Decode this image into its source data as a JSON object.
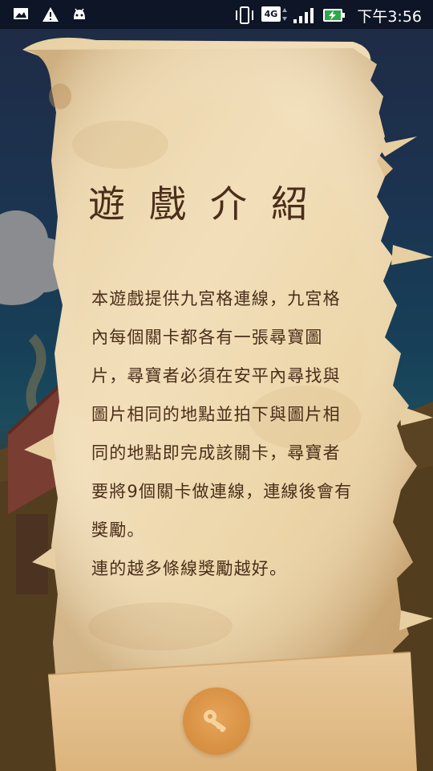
{
  "status_bar": {
    "time": "下午3:56",
    "network": "4G",
    "icons": [
      "image-icon",
      "warning-icon",
      "android-icon",
      "vibrate-icon",
      "network-4g-icon",
      "signal-icon",
      "battery-charging-icon"
    ]
  },
  "intro": {
    "title": "遊戲介紹",
    "paragraphs": [
      "本遊戲提供九宮格連線，九宮格內每個關卡都各有一張尋寶圖片，尋寶者必須在安平內尋找與圖片相同的地點並拍下與圖片相同的地點即完成該關卡，尋寶者要將9個關卡做連線，連線後會有獎勵。",
      "連的越多條線獎勵越好。"
    ]
  },
  "action": {
    "icon": "key-icon"
  },
  "colors": {
    "parchment": "#efd9b0",
    "text": "#4a2e1a",
    "key_button": "#d99244",
    "status_bar": "#0d1526"
  }
}
